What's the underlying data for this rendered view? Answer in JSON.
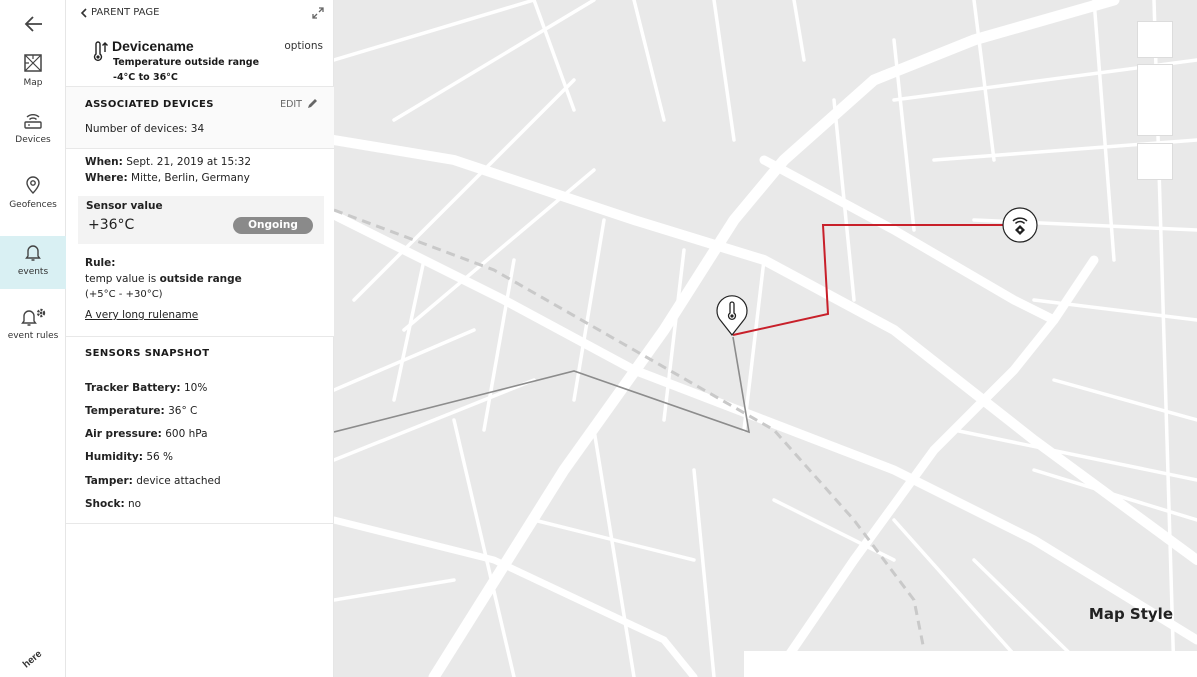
{
  "nav": {
    "items": [
      {
        "label": "Map",
        "icon": "map-icon"
      },
      {
        "label": "Devices",
        "icon": "router-icon"
      },
      {
        "label": "Geofences",
        "icon": "geofence-pin-icon"
      },
      {
        "label": "events",
        "icon": "bell-icon"
      },
      {
        "label": "event rules",
        "icon": "bell-gear-icon"
      }
    ],
    "active": "events",
    "logo_text": "here"
  },
  "panel": {
    "parent_label": "PARENT PAGE",
    "device_name": "Devicename",
    "alert_title": "Temperature outside range",
    "alert_range": "-4°C to 36°C",
    "options_label": "options",
    "associated": {
      "title": "ASSOCIATED DEVICES",
      "edit_label": "EDIT",
      "count_text": "Number of devices: 34"
    },
    "event": {
      "when_label": "When:",
      "when_value": "Sept. 21, 2019 at 15:32",
      "where_label": "Where:",
      "where_value": "Mitte, Berlin, Germany",
      "sensor_label": "Sensor value",
      "sensor_value": "+36°C",
      "status": "Ongoing",
      "rule_label": "Rule:",
      "rule_prefix": "temp value is ",
      "rule_bold": "outside range",
      "rule_range": "(+5°C - +30°C)",
      "rule_link": "A very long rulename"
    },
    "snapshot": {
      "title": "SENSORS SNAPSHOT",
      "rows": [
        {
          "label": "Tracker Battery:",
          "value": "10%"
        },
        {
          "label": "Temperature:",
          "value": "36° C"
        },
        {
          "label": "Air pressure:",
          "value": "600 hPa"
        },
        {
          "label": "Humidity:",
          "value": "56 %"
        },
        {
          "label": "Tamper:",
          "value": "device attached"
        },
        {
          "label": "Shock:",
          "value": "no"
        }
      ]
    }
  },
  "map": {
    "style_label": "Map Style",
    "route_color": "#c8202a",
    "history_color": "#8c8c8c",
    "markers": [
      "thermometer-marker-icon",
      "tracker-marker-icon"
    ]
  }
}
